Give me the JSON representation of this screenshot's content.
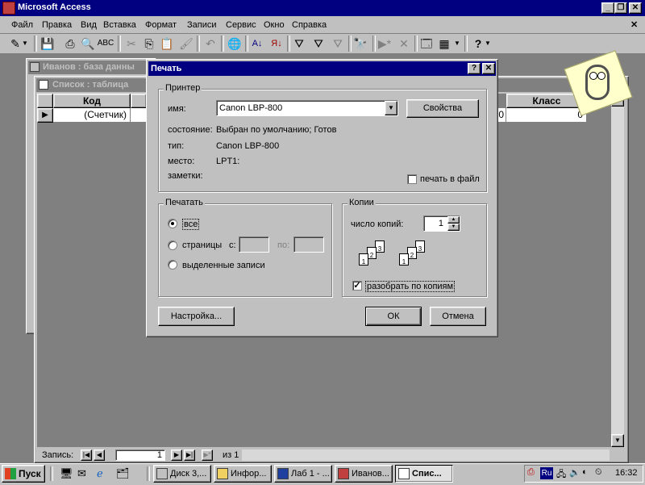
{
  "app": {
    "title": "Microsoft Access",
    "menu": [
      "Файл",
      "Правка",
      "Вид",
      "Вставка",
      "Формат",
      "Записи",
      "Сервис",
      "Окно",
      "Справка"
    ],
    "menu_accel": [
      "Ф",
      "П",
      "В",
      "В",
      "Ф",
      "З",
      "С",
      "О",
      "С"
    ]
  },
  "db_window": {
    "title": "Иванов : база данны"
  },
  "table_window": {
    "title": "Список : таблица",
    "columns": [
      "Код",
      "Класс"
    ],
    "row": {
      "marker": "▶",
      "kod": "(Счетчик)",
      "val_mid": "0",
      "klass": "0"
    }
  },
  "dialog": {
    "title": "Печать",
    "help_btn": "?",
    "close_btn": "✕",
    "printer": {
      "group_label": "Принтер",
      "name_label": "имя:",
      "name_value": "Canon LBP-800",
      "properties_btn": "Свойства",
      "status_label": "состояние:",
      "status_value": "Выбран по умолчанию; Готов",
      "type_label": "тип:",
      "type_value": "Canon LBP-800",
      "place_label": "место:",
      "place_value": "LPT1:",
      "notes_label": "заметки:",
      "print_to_file": "печать в файл"
    },
    "print_range": {
      "group_label": "Печатать",
      "all": "все",
      "pages": "страницы",
      "from": "с:",
      "to": "по:",
      "selected": "выделенные записи"
    },
    "copies": {
      "group_label": "Копии",
      "count_label": "число копий:",
      "count_value": "1",
      "collate": "разобрать по копиям"
    },
    "setup_btn": "Настройка...",
    "ok_btn": "ОК",
    "cancel_btn": "Отмена"
  },
  "record_nav": {
    "label": "Запись:",
    "current": "1",
    "of": "из 1"
  },
  "taskbar": {
    "start": "Пуск",
    "tasks": [
      "Диск 3,...",
      "Инфор...",
      "Лаб 1 - ...",
      "Иванов...",
      "Спис..."
    ],
    "lang": "Ru",
    "clock": "16:32"
  },
  "colors": {
    "title_active": "#000080",
    "face": "#c0c0c0",
    "desktop": "#808080"
  }
}
